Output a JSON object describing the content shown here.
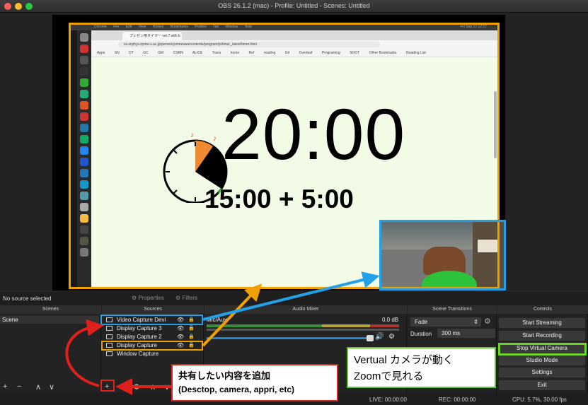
{
  "window": {
    "title": "OBS 26.1.2 (mac) - Profile: Untitled - Scenes: Untitled"
  },
  "captured_screen": {
    "menubar": [
      "Chrome",
      "File",
      "Edit",
      "View",
      "History",
      "Bookmarks",
      "Profiles",
      "Tab",
      "Window",
      "Help"
    ],
    "menubar_right": "Fri Sep 17 12:17",
    "tab_title": "プレゼン用タイマー ver.7 with b",
    "url": "ss.scphys.kyoto-u.ac.jp/person/yonezawa/contents/program/js/timer_latest/timer.html",
    "bookmarks": [
      "Apps",
      "SN",
      "DT",
      "GC",
      "GM",
      "CSRN",
      "ALICE",
      "Trans",
      "home",
      "Ref",
      "reading",
      "Git",
      "Overleaf",
      "Programing",
      "SOOT"
    ],
    "bookmarks_right": [
      "Other Bookmarks",
      "Reading List"
    ],
    "timer_main": "20:00",
    "timer_sub": "15:00 + 5:00"
  },
  "status": {
    "no_source": "No source selected",
    "properties": "Properties",
    "filters": "Filters"
  },
  "docks": {
    "scenes_title": "Scenes",
    "sources_title": "Sources",
    "mixer_title": "Audio Mixer",
    "transitions_title": "Scene Transitions",
    "controls_title": "Controls"
  },
  "scenes": [
    "Scene"
  ],
  "sources": [
    {
      "label": "Video Capture Devi"
    },
    {
      "label": "Display Capture 3"
    },
    {
      "label": "Display Capture 2"
    },
    {
      "label": "Display Capture"
    },
    {
      "label": "Window Capture"
    }
  ],
  "mixer": {
    "channel": "Mic/Aux",
    "level": "0.0 dB"
  },
  "transitions": {
    "type": "Fade",
    "duration_label": "Duration",
    "duration_value": "300 ms"
  },
  "controls": {
    "start_streaming": "Start Streaming",
    "start_recording": "Start Recording",
    "stop_virtual_camera": "Stop Virtual Camera",
    "studio_mode": "Studio Mode",
    "settings": "Settings",
    "exit": "Exit"
  },
  "footer": {
    "live": "LIVE: 00:00:00",
    "rec": "REC: 00:00:00",
    "cpu": "CPU: 5.7%, 30.00 fps"
  },
  "annotations": {
    "red_line1": "共有したい内容を追加",
    "red_line2": "(Desctop, camera, appri, etc)",
    "green_line1": "Vertual カメラが動く",
    "green_line2": "Zoomで見れる"
  },
  "colors": {
    "accent_orange": "#f0a000",
    "accent_blue": "#22a0e8",
    "accent_red": "#e0201b",
    "accent_green": "#5ec42a"
  }
}
